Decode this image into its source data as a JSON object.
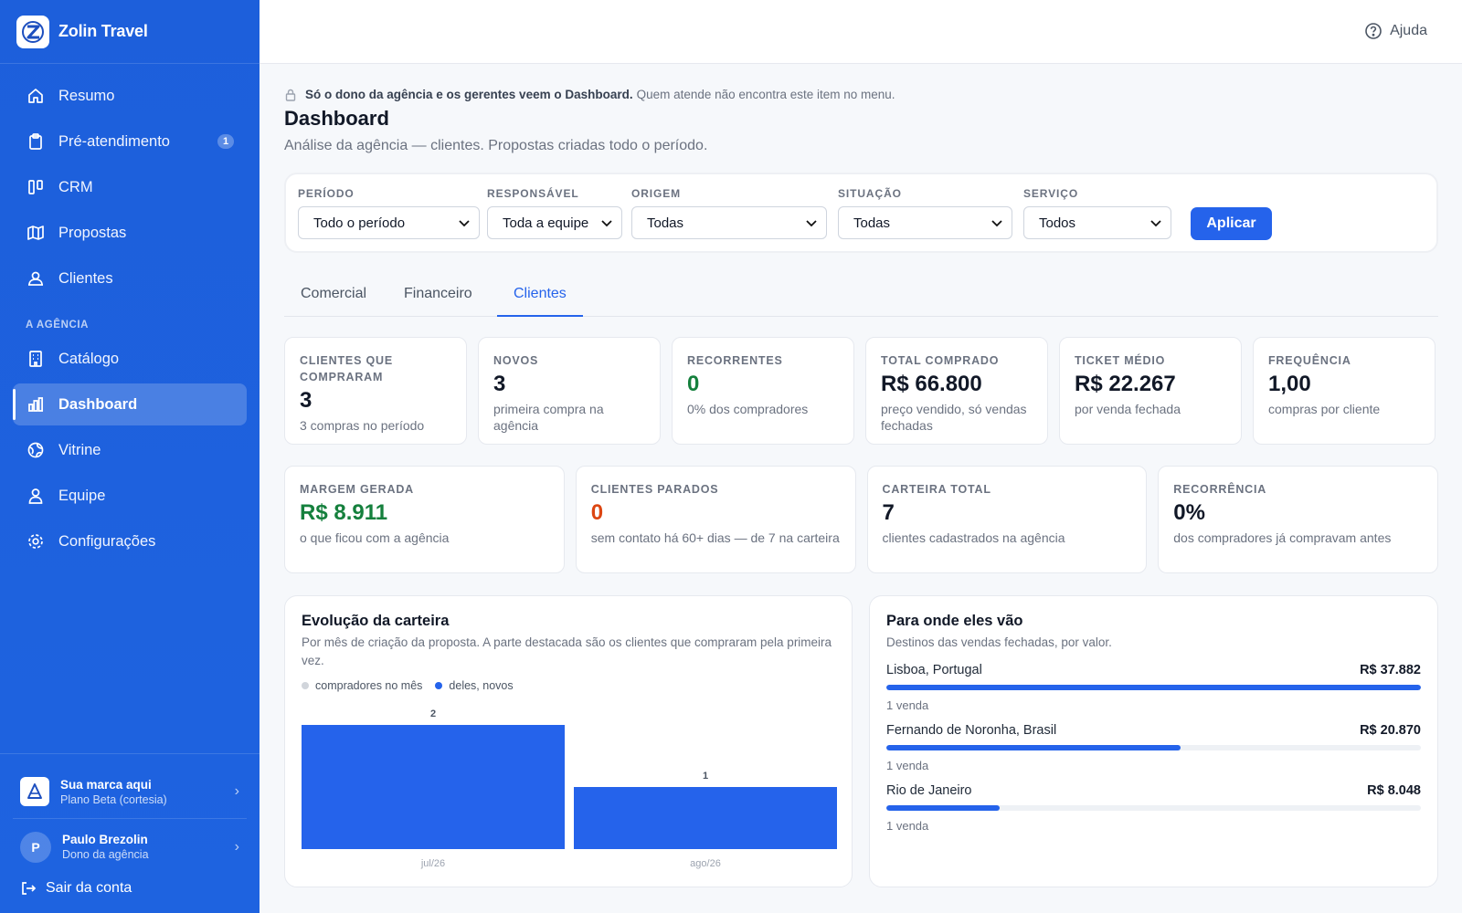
{
  "brand": {
    "name": "Zolin Travel"
  },
  "nav": {
    "items": [
      {
        "label": "Resumo",
        "icon": "home-icon"
      },
      {
        "label": "Pré-atendimento",
        "icon": "clipboard-icon",
        "badge": "1"
      },
      {
        "label": "CRM",
        "icon": "kanban-icon"
      },
      {
        "label": "Propostas",
        "icon": "map-icon"
      },
      {
        "label": "Clientes",
        "icon": "users-icon"
      }
    ],
    "section_label": "A AGÊNCIA",
    "agency_items": [
      {
        "label": "Catálogo",
        "icon": "building-icon"
      },
      {
        "label": "Dashboard",
        "icon": "bar-chart-icon",
        "active": true
      },
      {
        "label": "Vitrine",
        "icon": "globe-icon"
      },
      {
        "label": "Equipe",
        "icon": "user-icon"
      },
      {
        "label": "Configurações",
        "icon": "gear-icon"
      }
    ]
  },
  "account": {
    "brand_title": "Sua marca aqui",
    "brand_sub": "Plano Beta (cortesia)",
    "user_initial": "P",
    "user_name": "Paulo Brezolin",
    "user_role": "Dono da agência",
    "logout": "Sair da conta"
  },
  "topbar": {
    "help": "Ajuda"
  },
  "page": {
    "note_bold": "Só o dono da agência e os gerentes veem o Dashboard.",
    "note_rest": "Quem atende não encontra este item no menu.",
    "title": "Dashboard",
    "subtitle": "Análise da agência — clientes. Propostas criadas todo o período."
  },
  "filters": {
    "periodo": {
      "label": "PERÍODO",
      "value": "Todo o período"
    },
    "responsavel": {
      "label": "RESPONSÁVEL",
      "value": "Toda a equipe"
    },
    "origem": {
      "label": "ORIGEM",
      "value": "Todas"
    },
    "situacao": {
      "label": "SITUAÇÃO",
      "value": "Todas"
    },
    "servico": {
      "label": "SERVIÇO",
      "value": "Todos"
    },
    "apply": "Aplicar"
  },
  "tabs": [
    {
      "label": "Comercial"
    },
    {
      "label": "Financeiro"
    },
    {
      "label": "Clientes",
      "active": true
    }
  ],
  "stats_row1": [
    {
      "label": "CLIENTES QUE COMPRARAM",
      "value": "3",
      "desc": "3 compras no período"
    },
    {
      "label": "NOVOS",
      "value": "3",
      "desc": "primeira compra na agência"
    },
    {
      "label": "RECORRENTES",
      "value": "0",
      "desc": "0% dos compradores",
      "tone": "green"
    },
    {
      "label": "TOTAL COMPRADO",
      "value": "R$ 66.800",
      "desc": "preço vendido, só vendas fechadas"
    },
    {
      "label": "TICKET MÉDIO",
      "value": "R$ 22.267",
      "desc": "por venda fechada"
    },
    {
      "label": "FREQUÊNCIA",
      "value": "1,00",
      "desc": "compras por cliente"
    }
  ],
  "stats_row2": [
    {
      "label": "MARGEM GERADA",
      "value": "R$ 8.911",
      "desc": "o que ficou com a agência",
      "tone": "green"
    },
    {
      "label": "CLIENTES PARADOS",
      "value": "0",
      "desc": "sem contato há 60+ dias — de 7 na carteira",
      "tone": "red"
    },
    {
      "label": "CARTEIRA TOTAL",
      "value": "7",
      "desc": "clientes cadastrados na agência"
    },
    {
      "label": "RECORRÊNCIA",
      "value": "0%",
      "desc": "dos compradores já compravam antes"
    }
  ],
  "evolucao": {
    "title": "Evolução da carteira",
    "subtitle": "Por mês de criação da proposta. A parte destacada são os clientes que compraram pela primeira vez.",
    "legend_buyers": "compradores no mês",
    "legend_new": "deles, novos",
    "colors": {
      "buyers": "#d1d5db",
      "new": "#2563eb"
    }
  },
  "chart_data": {
    "type": "bar",
    "categories": [
      "jul/26",
      "ago/26"
    ],
    "series": [
      {
        "name": "compradores no mês",
        "values": [
          2,
          1
        ]
      },
      {
        "name": "deles, novos",
        "values": [
          2,
          1
        ]
      }
    ],
    "data_labels": [
      "2",
      "1"
    ],
    "ylim": [
      0,
      2
    ],
    "grid": false,
    "legend": "top-left"
  },
  "destinos": {
    "title": "Para onde eles vão",
    "subtitle": "Destinos das vendas fechadas, por valor.",
    "items": [
      {
        "name": "Lisboa, Portugal",
        "value": "R$ 37.882",
        "count": "1 venda",
        "fraction": 1.0
      },
      {
        "name": "Fernando de Noronha, Brasil",
        "value": "R$ 20.870",
        "count": "1 venda",
        "fraction": 0.551
      },
      {
        "name": "Rio de Janeiro",
        "value": "R$ 8.048",
        "count": "1 venda",
        "fraction": 0.212
      }
    ]
  }
}
